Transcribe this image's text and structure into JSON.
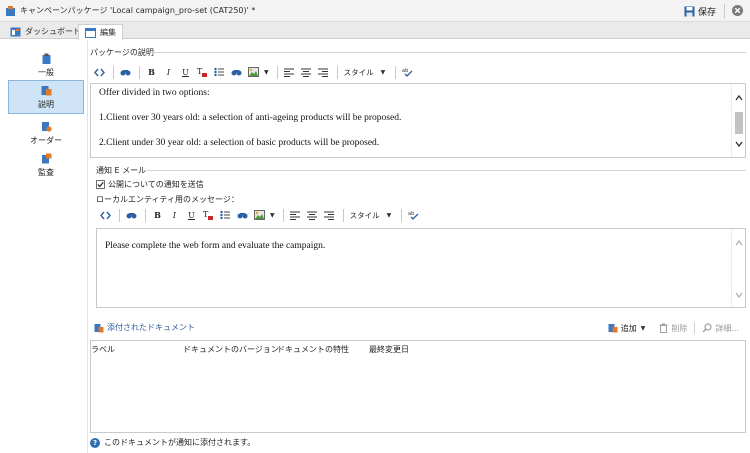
{
  "window": {
    "title": "キャンペーンパッケージ 'Local campaign_pro-set (CAT250)' *",
    "save_label": "保存"
  },
  "tabs": [
    {
      "label": "ダッシュボード"
    },
    {
      "label": "編集"
    }
  ],
  "sidebar": {
    "items": [
      {
        "label": "一般",
        "icon": "general-icon"
      },
      {
        "label": "説明",
        "icon": "description-icon",
        "active": true
      },
      {
        "label": "オーダー",
        "icon": "order-icon"
      },
      {
        "label": "監査",
        "icon": "audit-icon"
      }
    ]
  },
  "description": {
    "section_label": "パッケージの説明",
    "style_label": "スタイル",
    "lines": [
      "Offer divided in two options:",
      "1.Client over 30 years old: a selection of anti-ageing products will be proposed.",
      "2.Client under 30 year old: a selection of basic products will be proposed."
    ]
  },
  "notification": {
    "section_label": "通知 E メール",
    "checkbox_label": "公開についての通知を送信",
    "checkbox_checked": true,
    "message_label": "ローカルエンティティ用のメッセージ：",
    "style_label": "スタイル",
    "message": "Please complete the web form and evaluate the campaign."
  },
  "attachments": {
    "title": "添付されたドキュメント",
    "add_label": "追加",
    "delete_label": "削除",
    "detail_label": "詳細...",
    "columns": [
      "ラベル",
      "ドキュメントのバージョン",
      "ドキュメントの特性",
      "最終変更日"
    ],
    "note": "このドキュメントが通知に添付されます。"
  },
  "colors": {
    "accent": "#2f6fb3",
    "active_nav_bg": "#cfe5f7",
    "link": "#2d5c9c"
  }
}
